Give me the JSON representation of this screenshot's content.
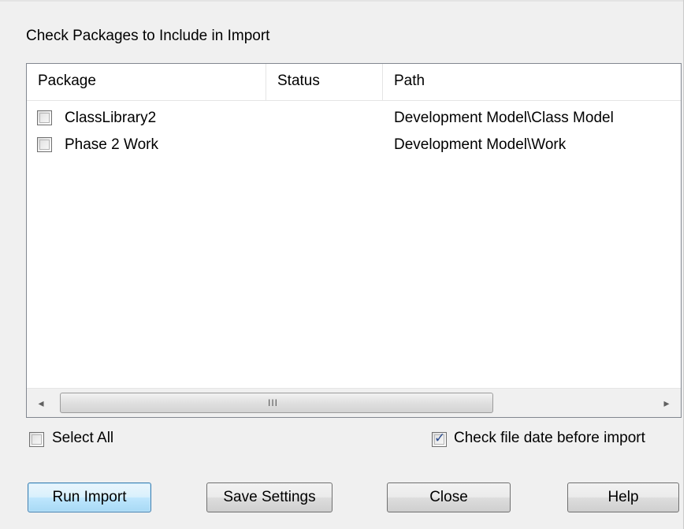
{
  "dialog": {
    "heading": "Check Packages to Include in Import"
  },
  "list": {
    "columns": [
      "Package",
      "Status",
      "Path"
    ],
    "rows": [
      {
        "package": "ClassLibrary2",
        "status": "",
        "path": "Development Model\\Class Model",
        "checked": false
      },
      {
        "package": "Phase 2 Work",
        "status": "",
        "path": "Development Model\\Work",
        "checked": false
      }
    ],
    "scrollbar": {
      "left_arrow": "◂",
      "right_arrow": "▸",
      "grip": "III"
    }
  },
  "options": {
    "select_all_label": "Select All",
    "select_all_checked": false,
    "check_date_label": "Check file date before import",
    "check_date_checked": true,
    "checkmark_glyph": "✓"
  },
  "buttons": {
    "run_import": "Run Import",
    "save_settings": "Save Settings",
    "close": "Close",
    "help": "Help"
  },
  "colors": {
    "dialog_bg": "#f0f0f0",
    "default_button_border": "#3c7fb1",
    "checkmark": "#2a4b8d"
  },
  "icons": {
    "scroll_left": "chevron-left-icon",
    "scroll_right": "chevron-right-icon",
    "check": "checkmark-icon"
  }
}
